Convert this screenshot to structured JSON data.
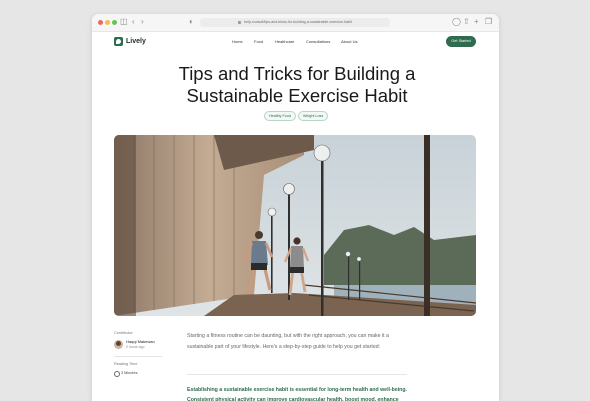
{
  "browser": {
    "url": "help.consult/tips-and-tricks-for-building-a-sustainable-exercise-habit",
    "icons": [
      "sidebar-icon",
      "back-icon",
      "forward-icon",
      "shield-icon",
      "download-icon",
      "share-icon",
      "new-tab-icon",
      "tabs-icon"
    ]
  },
  "site": {
    "logo": "Lively",
    "nav": [
      "Home",
      "Food",
      "Healthcare",
      "Consultations",
      "About Us"
    ],
    "cta": "Get Started",
    "accent": "#2e6b4f"
  },
  "article": {
    "title": "Tips and Tricks for Building a Sustainable Exercise Habit",
    "tags": [
      "Healthy Food",
      "Weight Loss"
    ],
    "hero_alt": "Two runners jogging along a wooden waterfront boardwalk",
    "contributor_label": "Contributor",
    "author": "Haqqi Makewan",
    "posted": "2 hours ago",
    "reading_label": "Reading Time",
    "reading_time": "3 Minutes",
    "intro": "Starting a fitness routine can be daunting, but with the right approach, you can make it a sustainable part of your lifestyle. Here's a step-by-step guide to help you get started:",
    "highlight": "Establishing a sustainable exercise habit is essential for long-term health and well-being. Consistent physical activity can improve cardiovascular health, boost mood, enhance energy levels, and reduce the risk of chronic diseases. Here are"
  }
}
